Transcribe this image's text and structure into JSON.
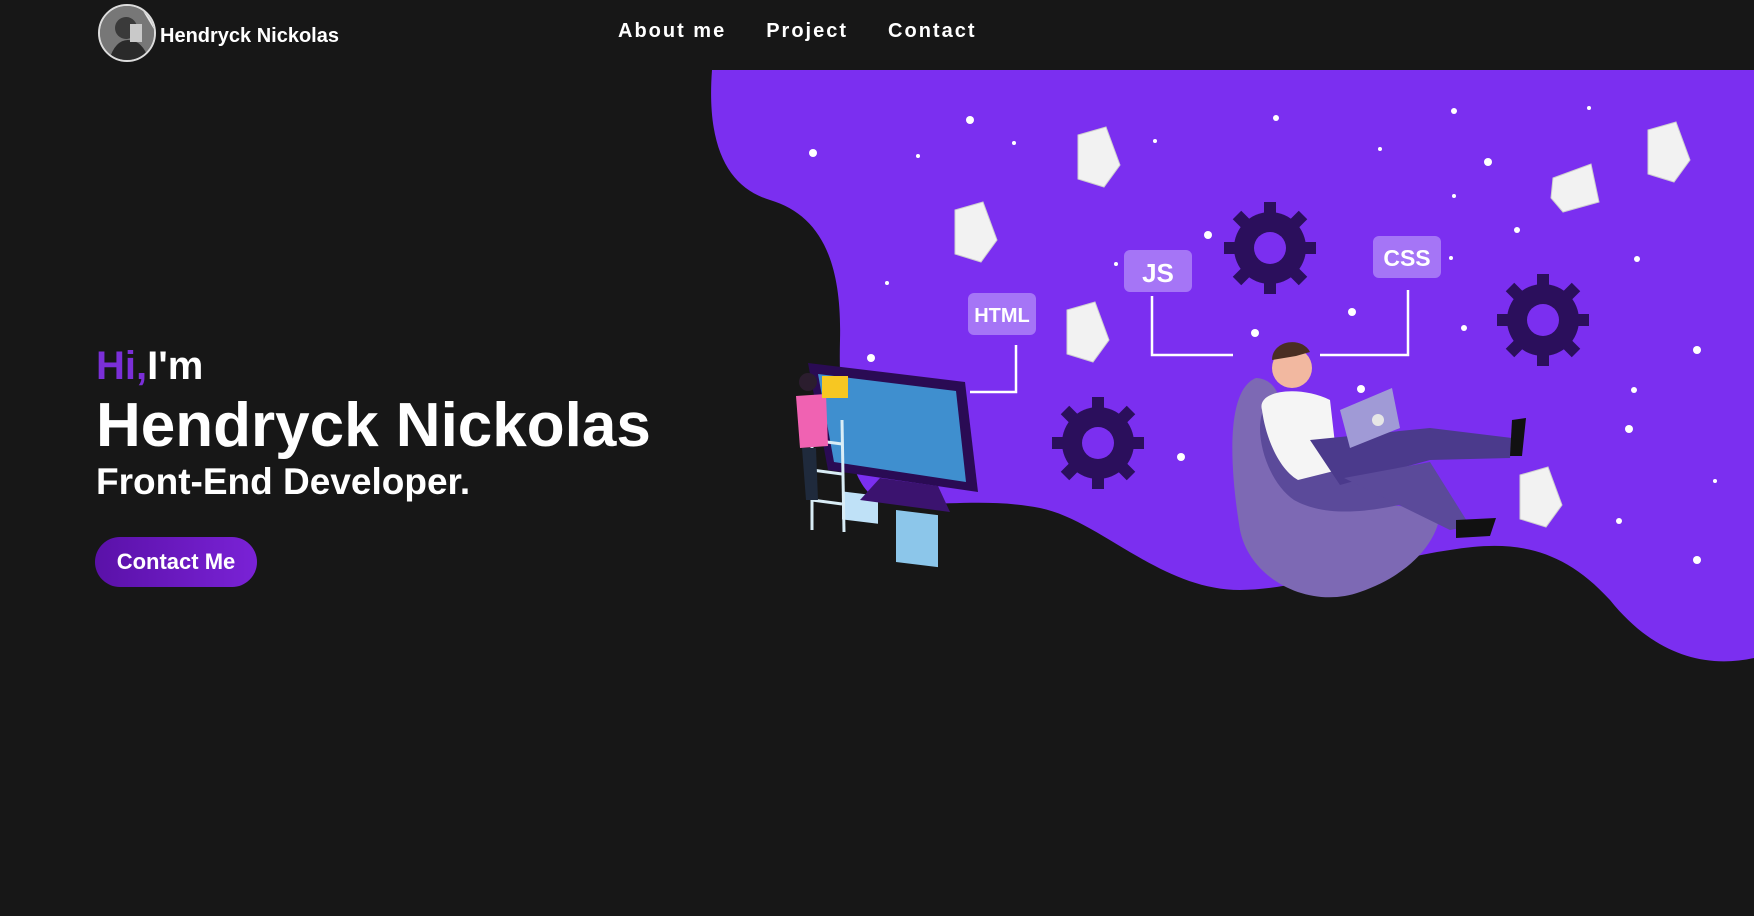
{
  "nav": {
    "brand_name": "Hendryck Nickolas",
    "links": [
      {
        "label": "About me"
      },
      {
        "label": "Project"
      },
      {
        "label": "Contact"
      }
    ]
  },
  "hero": {
    "greeting_hi": "Hi,",
    "greeting_im": "I'm",
    "name": "Hendryck Nickolas",
    "role": "Front-End Developer.",
    "cta_label": "Contact Me"
  },
  "illustration": {
    "tags": [
      "HTML",
      "JS",
      "CSS"
    ]
  },
  "colors": {
    "background": "#171717",
    "accent": "#7b2fd8",
    "blob": "#7b2ff0",
    "button": "#6a1bc4"
  }
}
